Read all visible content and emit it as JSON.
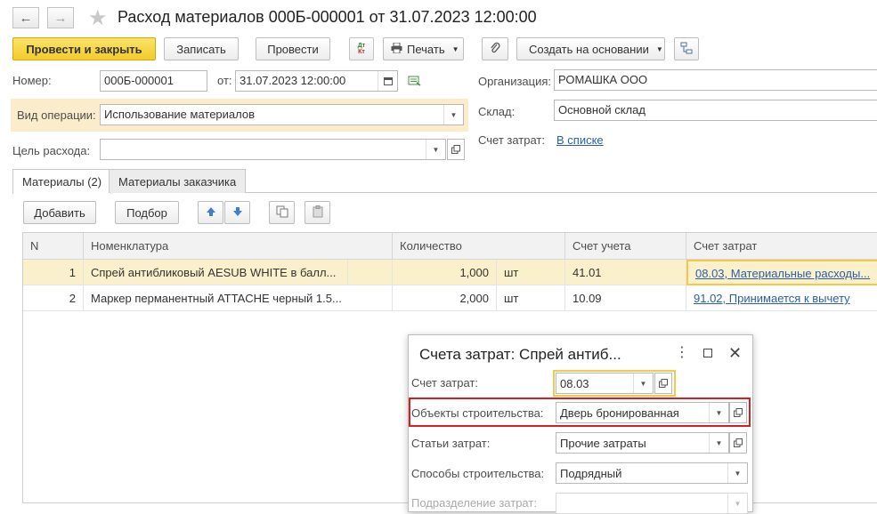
{
  "window": {
    "title": "Расход материалов 000Б-000001 от 31.07.2023 12:00:00"
  },
  "toolbar": {
    "post_close": "Провести и закрыть",
    "save": "Записать",
    "post": "Провести",
    "dtkt_top": "Дт",
    "dtkt_bottom": "Кт",
    "print": "Печать",
    "create_based": "Создать на основании"
  },
  "header": {
    "number_label": "Номер:",
    "number_value": "000Б-000001",
    "date_label": "от:",
    "date_value": "31.07.2023 12:00:00",
    "operation_label": "Вид операции:",
    "operation_value": "Использование материалов",
    "purpose_label": "Цель расхода:",
    "purpose_value": "",
    "org_label": "Организация:",
    "org_value": "РОМАШКА ООО",
    "warehouse_label": "Склад:",
    "warehouse_value": "Основной склад",
    "cost_account_label": "Счет затрат:",
    "cost_account_link": "В списке"
  },
  "tabs": [
    {
      "label": "Материалы (2)"
    },
    {
      "label": "Материалы заказчика"
    }
  ],
  "table_toolbar": {
    "add": "Добавить",
    "select": "Подбор"
  },
  "table": {
    "columns": [
      "N",
      "Номенклатура",
      "Количество",
      "Счет учета",
      "Счет затрат"
    ],
    "rows": [
      {
        "n": "1",
        "name": "Спрей антибликовый AESUB WHITE в балл...",
        "qty": "1,000",
        "unit": "шт",
        "account": "41.01",
        "cost_account": "08.03, Материальные расходы..."
      },
      {
        "n": "2",
        "name": "Маркер перманентный ATTACHE черный 1.5...",
        "qty": "2,000",
        "unit": "шт",
        "account": "10.09",
        "cost_account": "91.02, Принимается к вычету"
      }
    ]
  },
  "popup": {
    "title": "Счета затрат:  Спрей антиб...",
    "fields": [
      {
        "label": "Счет затрат:",
        "value": "08.03"
      },
      {
        "label": "Объекты строительства:",
        "value": "Дверь бронированная"
      },
      {
        "label": "Статьи затрат:",
        "value": "Прочие затраты"
      },
      {
        "label": "Способы строительства:",
        "value": "Подрядный"
      },
      {
        "label": "Подразделение затрат:",
        "value": ""
      }
    ]
  },
  "colors": {
    "primary_button": "#f3cc2a",
    "highlight_field": "#f5c84a",
    "red_frame": "#d42020",
    "link": "#2b5ea8",
    "selected_row": "#fbf0cc",
    "operation_highlight": "#fbeccb"
  }
}
